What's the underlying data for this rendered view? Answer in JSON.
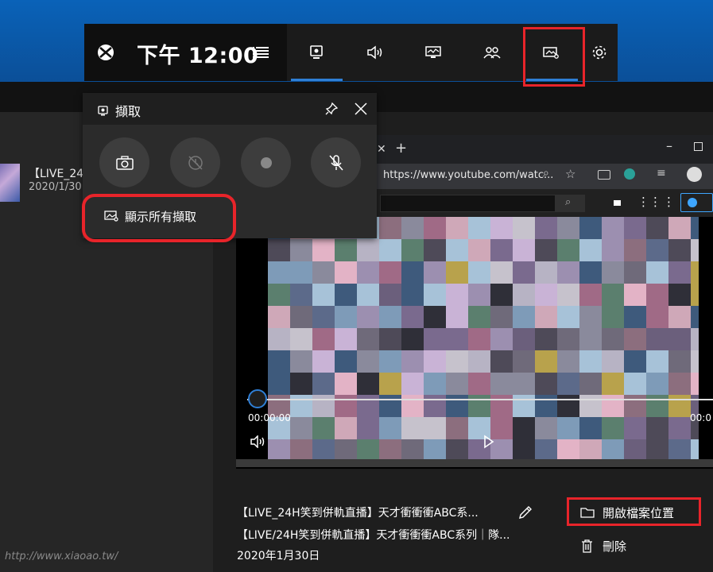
{
  "gamebar": {
    "time": "下午 12:00",
    "icons": [
      "xbox-icon",
      "menu-icon",
      "capture-widget-icon",
      "audio-icon",
      "performance-icon",
      "social-icon",
      "gallery-icon",
      "settings-icon"
    ]
  },
  "capture_widget": {
    "title": "擷取",
    "show_all_captures": "顯示所有擷取"
  },
  "gallery": {
    "list_item_title": "【LIVE_24",
    "list_item_date": "2020/1/30"
  },
  "browser": {
    "url": "https://www.youtube.com/watc..."
  },
  "player": {
    "time_current": "00:00:00",
    "time_end": "00:0"
  },
  "capture_details": {
    "title": "【LIVE_24H笑到併軌直播】天才衝衝衝ABC系...",
    "description": "【LIVE/24H笑到併軌直播】天才衝衝衝ABC系列｜隊...",
    "date": "2020年1月30日",
    "open_location": "開啟檔案位置",
    "delete": "刪除"
  },
  "watermark": "http://www.xiaoao.tw/"
}
